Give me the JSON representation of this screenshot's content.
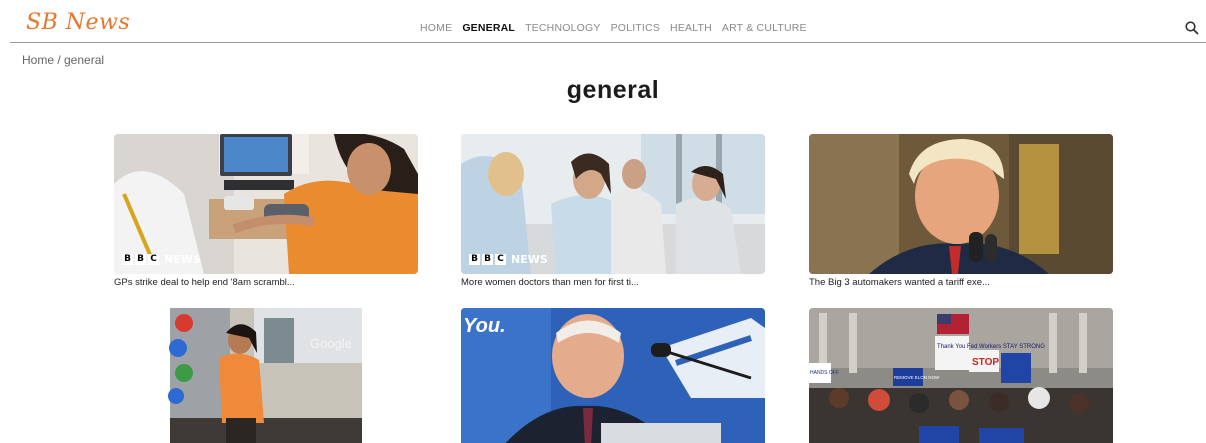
{
  "site": {
    "logo": "SB News"
  },
  "nav": {
    "items": [
      "HOME",
      "GENERAL",
      "TECHNOLOGY",
      "POLITICS",
      "HEALTH",
      "ART & CULTURE"
    ],
    "active_index": 1
  },
  "search": {
    "icon": "search-icon"
  },
  "breadcrumb": {
    "text": "Home / general"
  },
  "page": {
    "title": "general"
  },
  "articles": [
    {
      "caption": "GPs strike deal to help end '8am scrambl...",
      "badge": {
        "letters": [
          "B",
          "B",
          "C"
        ],
        "word": "NEWS"
      }
    },
    {
      "caption": "More women doctors than men for first ti...",
      "badge": {
        "letters": [
          "B",
          "B",
          "C"
        ],
        "word": "NEWS"
      }
    },
    {
      "caption": "The Big 3 automakers wanted a tariff exe..."
    },
    {
      "caption": ""
    },
    {
      "caption": ""
    },
    {
      "caption": ""
    }
  ],
  "image_text": {
    "google_sign": "Google",
    "you_sign": "You.",
    "protest_sign_1": "Thank You Fed Workers STAY STRONG",
    "protest_sign_2": "STOP",
    "protest_sign_3": "HANDS OFF",
    "protest_sign_4": "REMOVE ELON NOW"
  }
}
